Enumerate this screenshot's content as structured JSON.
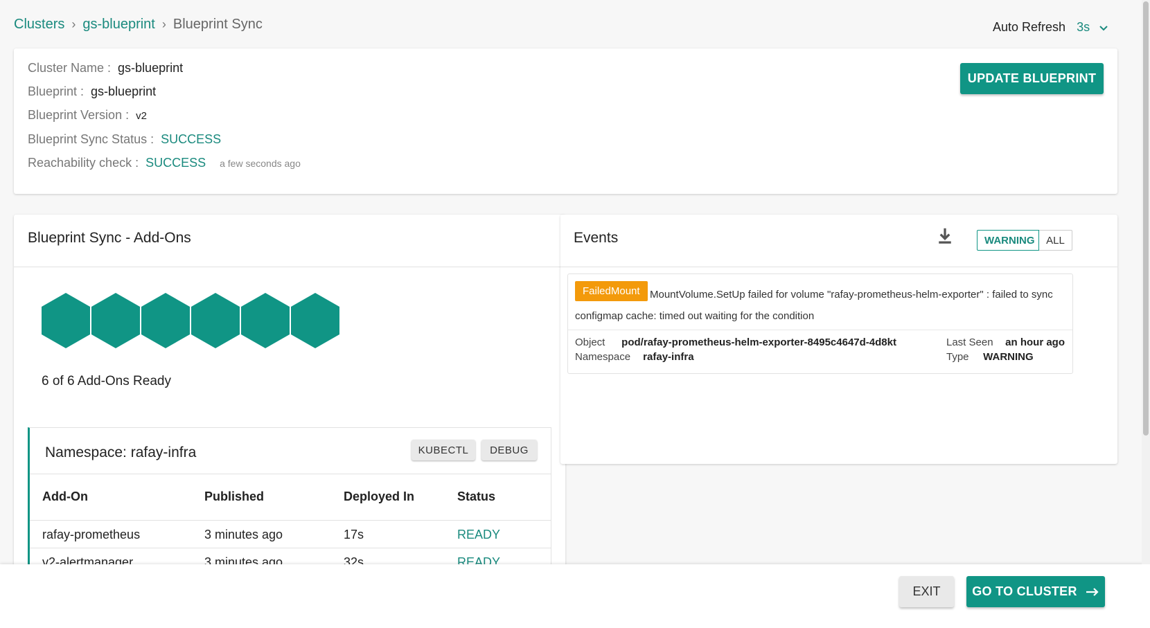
{
  "breadcrumb": {
    "items": [
      "Clusters",
      "gs-blueprint",
      "Blueprint Sync"
    ],
    "separator": "›"
  },
  "auto_refresh": {
    "label": "Auto Refresh",
    "value": "3s"
  },
  "summary": {
    "cluster_name_label": "Cluster Name :",
    "cluster_name": "gs-blueprint",
    "blueprint_label": "Blueprint :",
    "blueprint": "gs-blueprint",
    "blueprint_version_label": "Blueprint Version :",
    "blueprint_version": "v2",
    "sync_status_label": "Blueprint Sync Status :",
    "sync_status": "SUCCESS",
    "reachability_label": "Reachability check :",
    "reachability": "SUCCESS",
    "reachability_time": "a few seconds ago",
    "update_button": "UPDATE BLUEPRINT"
  },
  "addons": {
    "title": "Blueprint Sync - Add-Ons",
    "ready_count": 6,
    "total_count": 6,
    "ready_text": "6 of 6 Add-Ons Ready",
    "namespace_title": "Namespace: rafay-infra",
    "kubectl_button": "KUBECTL",
    "debug_button": "DEBUG",
    "columns": [
      "Add-On",
      "Published",
      "Deployed In",
      "Status"
    ],
    "rows": [
      {
        "name": "rafay-prometheus",
        "published": "3 minutes ago",
        "deployed_in": "17s",
        "status": "READY"
      },
      {
        "name": "v2-alertmanager",
        "published": "3 minutes ago",
        "deployed_in": "32s",
        "status": "READY"
      }
    ]
  },
  "events": {
    "title": "Events",
    "filter_warning": "WARNING",
    "filter_all": "ALL",
    "items": [
      {
        "reason": "FailedMount",
        "message": "MountVolume.SetUp failed for volume \"rafay-prometheus-helm-exporter\" : failed to sync configmap cache: timed out waiting for the condition",
        "object_label": "Object",
        "object": "pod/rafay-prometheus-helm-exporter-8495c4647d-4d8kt",
        "namespace_label": "Namespace",
        "namespace": "rafay-infra",
        "last_seen_label": "Last Seen",
        "last_seen": "an hour ago",
        "type_label": "Type",
        "type": "WARNING"
      }
    ]
  },
  "footer": {
    "exit_button": "EXIT",
    "goto_button": "GO TO CLUSTER"
  },
  "colors": {
    "accent": "#109585",
    "accent_text": "#1a8a7e",
    "warning_badge": "#f39a0b"
  }
}
